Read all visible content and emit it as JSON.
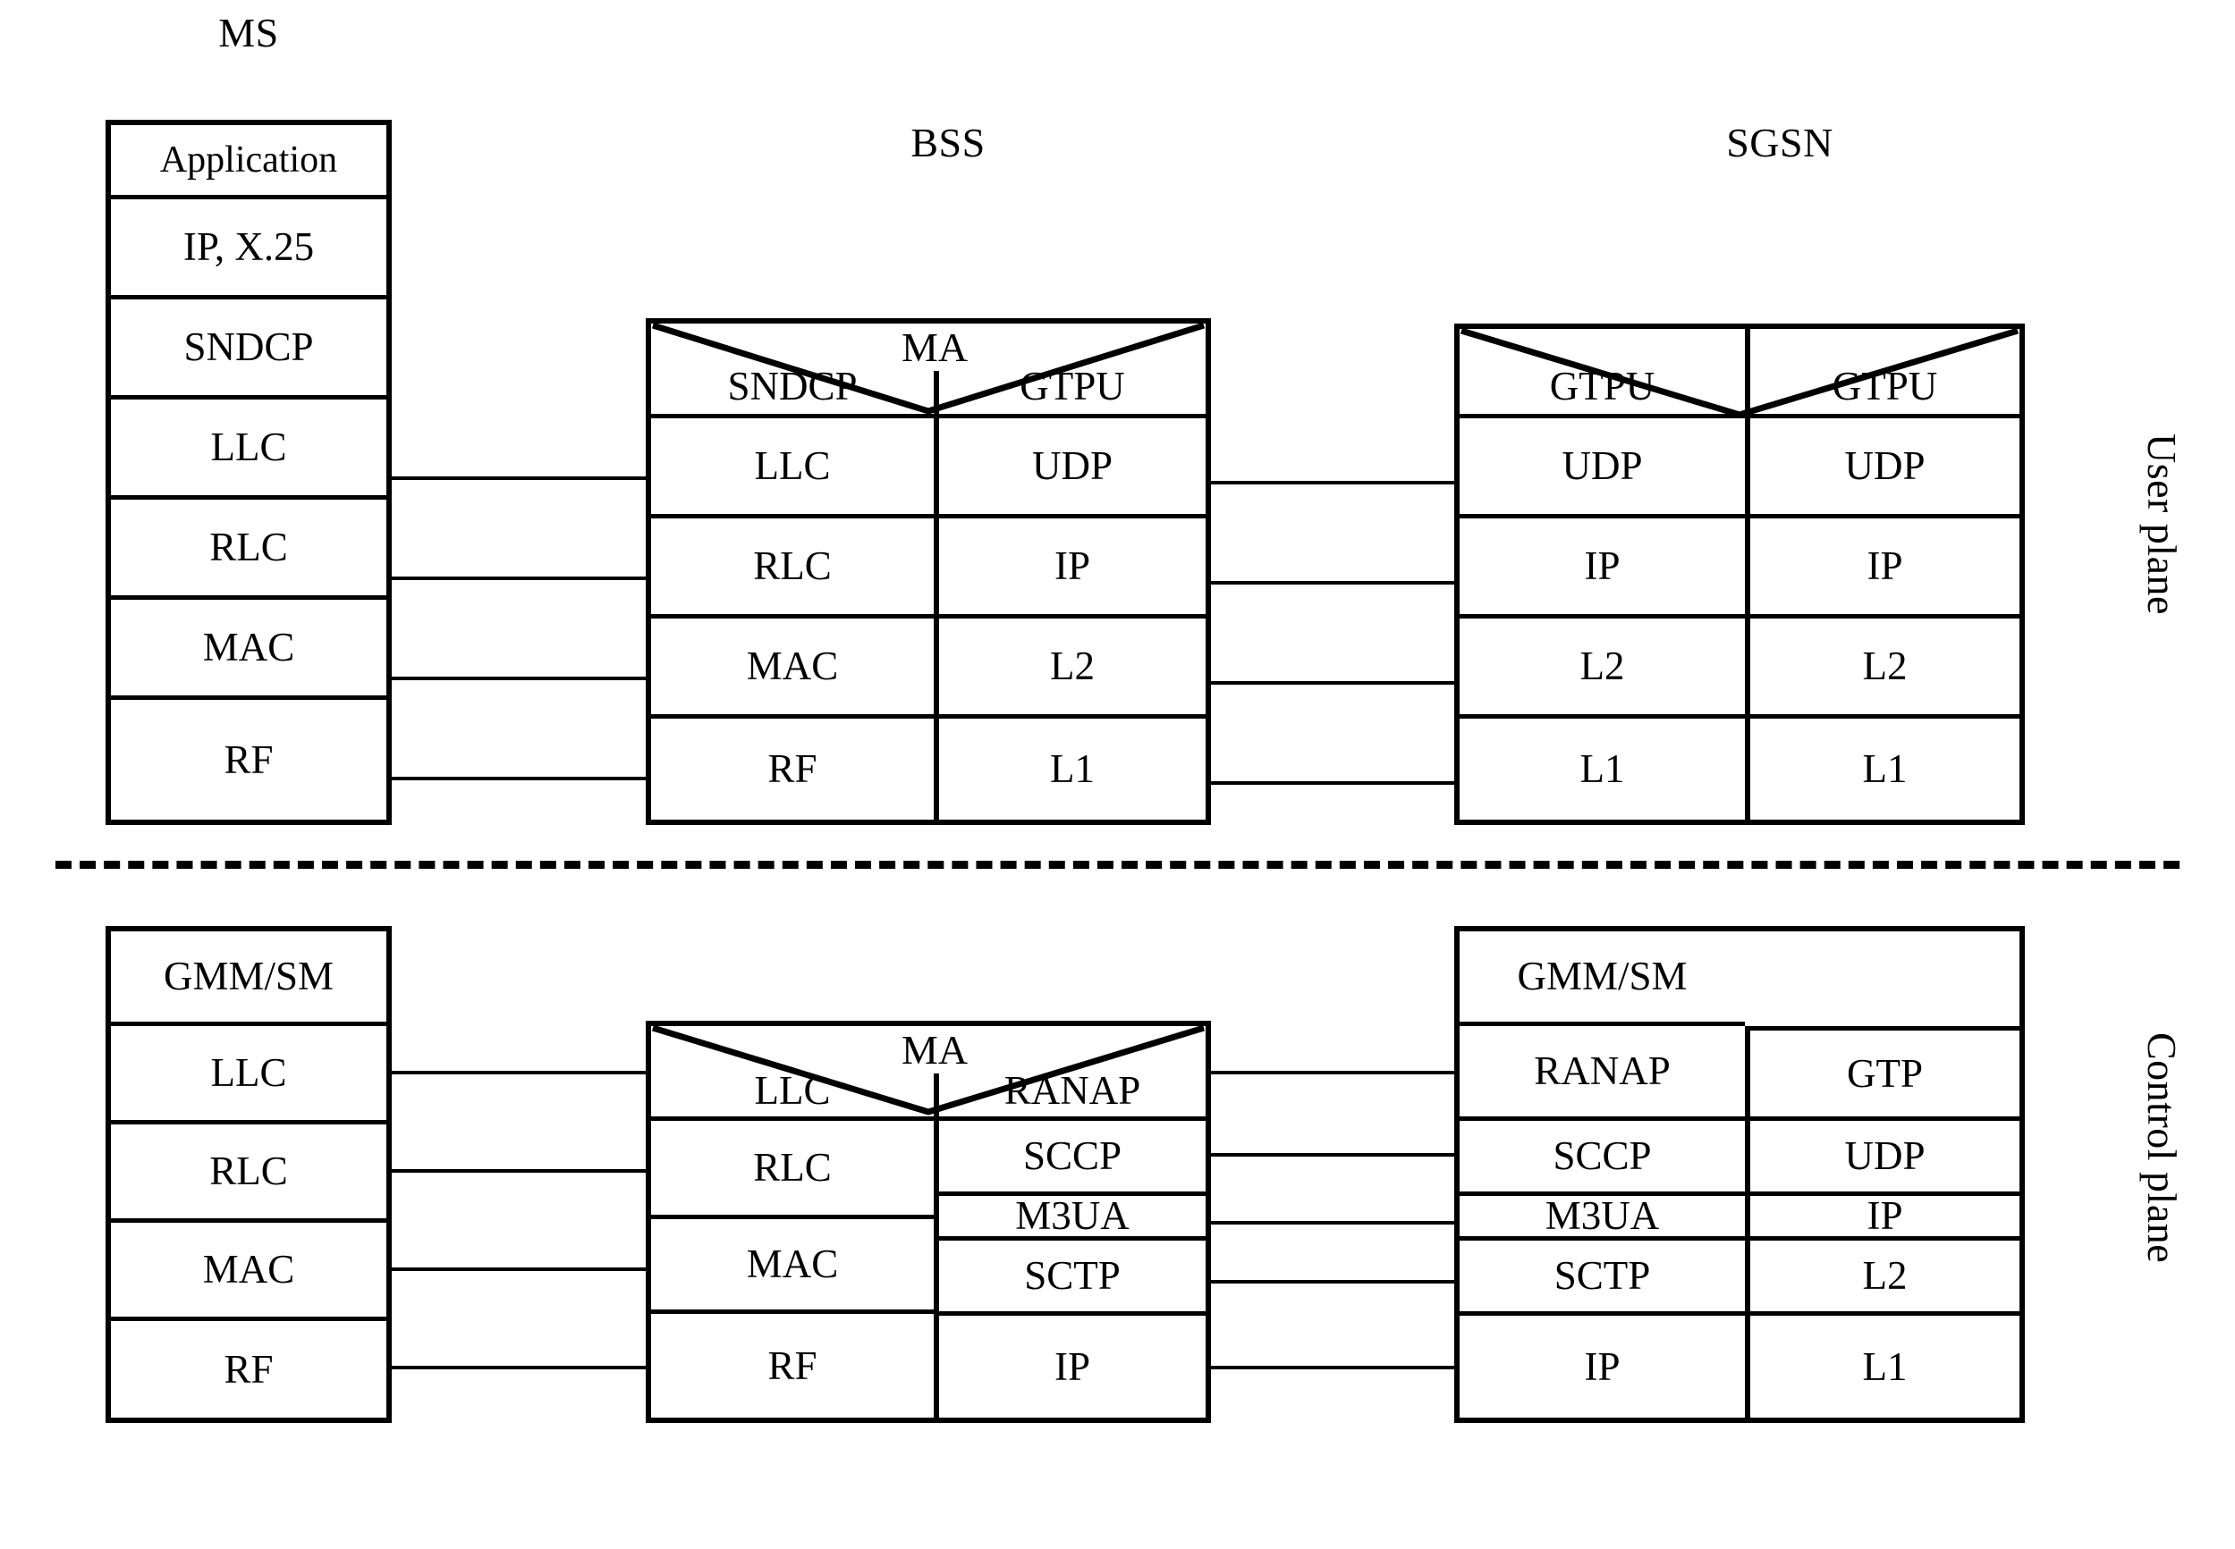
{
  "titles": {
    "ms": "MS",
    "bss": "BSS",
    "sgsn": "SGSN"
  },
  "plane_labels": {
    "user": "User plane",
    "control": "Control plane"
  },
  "ma_label": "MA",
  "user_plane": {
    "ms": {
      "layers": [
        "Application",
        "IP, X.25",
        "SNDCP",
        "LLC",
        "RLC",
        "MAC",
        "RF"
      ]
    },
    "bss": {
      "left": [
        "SNDCP",
        "LLC",
        "RLC",
        "MAC",
        "RF"
      ],
      "right": [
        "GTPU",
        "UDP",
        "IP",
        "L2",
        "L1"
      ]
    },
    "sgsn": {
      "left": [
        "GTPU",
        "UDP",
        "IP",
        "L2",
        "L1"
      ],
      "right": [
        "GTPU",
        "UDP",
        "IP",
        "L2",
        "L1"
      ]
    }
  },
  "control_plane": {
    "ms": {
      "layers": [
        "GMM/SM",
        "LLC",
        "RLC",
        "MAC",
        "RF"
      ]
    },
    "bss": {
      "left": [
        "LLC",
        "RLC",
        "MAC",
        "RF"
      ],
      "right": [
        "RANAP",
        "SCCP",
        "M3UA",
        "SCTP",
        "IP"
      ]
    },
    "sgsn": {
      "top_left": "GMM/SM",
      "left": [
        "RANAP",
        "SCCP",
        "M3UA",
        "SCTP",
        "IP"
      ],
      "right": [
        "GTP",
        "UDP",
        "IP",
        "L2",
        "L1"
      ]
    }
  }
}
